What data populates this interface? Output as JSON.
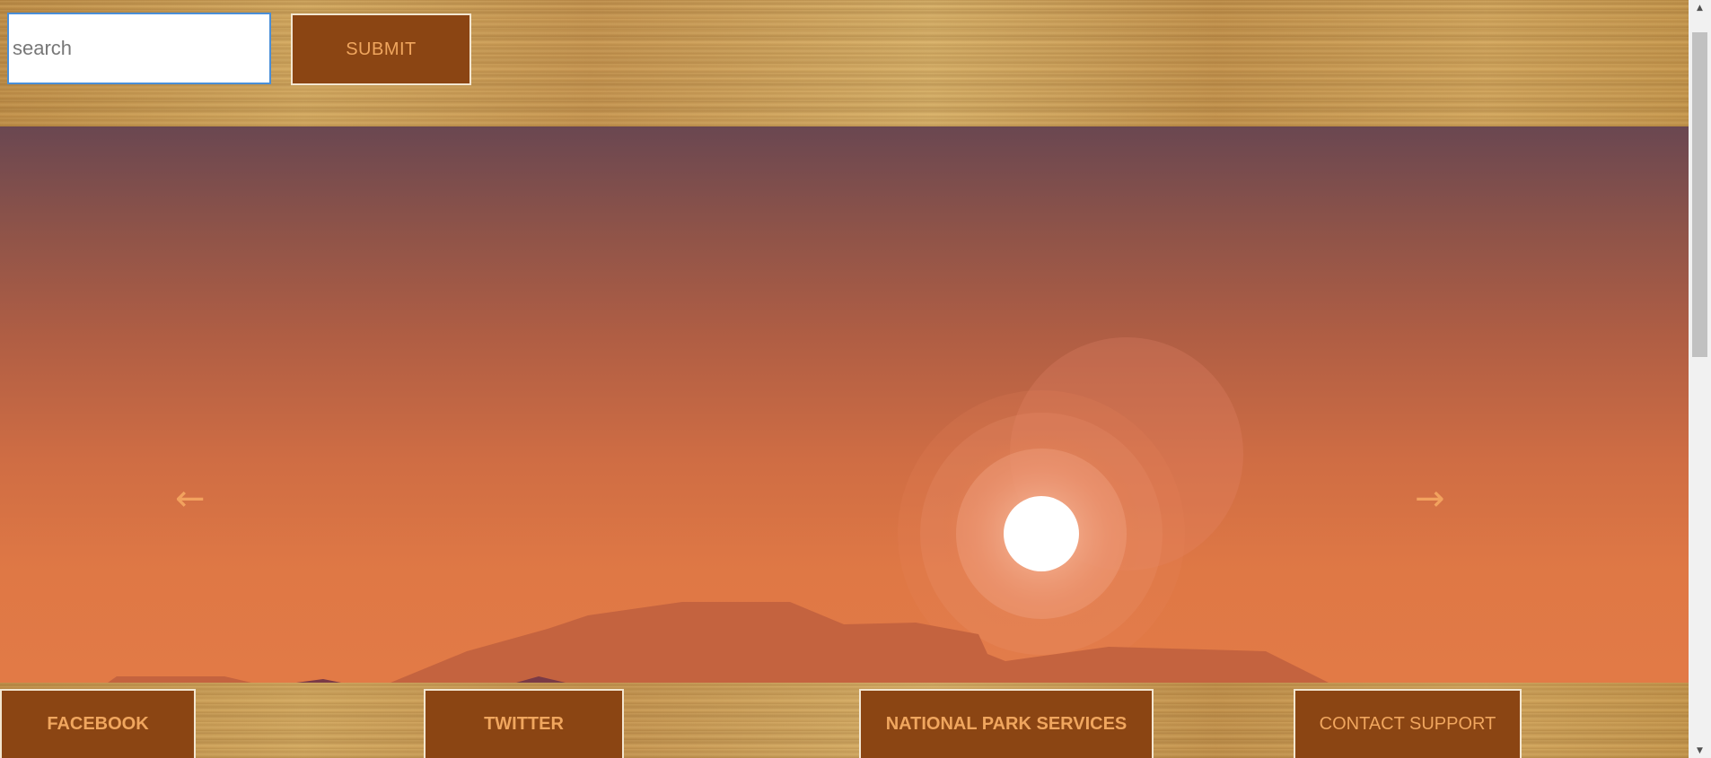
{
  "header": {
    "search": {
      "placeholder": "search",
      "value": ""
    },
    "submit_label": "SUBMIT"
  },
  "slider": {
    "prev_label": "←",
    "next_label": "→"
  },
  "footer": {
    "links": [
      {
        "label": "FACEBOOK"
      },
      {
        "label": "TWITTER"
      },
      {
        "label": "NATIONAL PARK SERVICES"
      },
      {
        "label": "CONTACT SUPPORT"
      }
    ]
  },
  "colors": {
    "button_bg": "#8b4513",
    "button_text": "#f0a65e",
    "button_border": "#f3e6d0",
    "sky_top": "#6a4751",
    "sky_bottom": "#e27a46",
    "sun": "#ffffff"
  },
  "icons": {
    "prev": "left-arrow-icon",
    "next": "right-arrow-icon",
    "scroll_up": "scroll-up-icon",
    "scroll_down": "scroll-down-icon"
  }
}
